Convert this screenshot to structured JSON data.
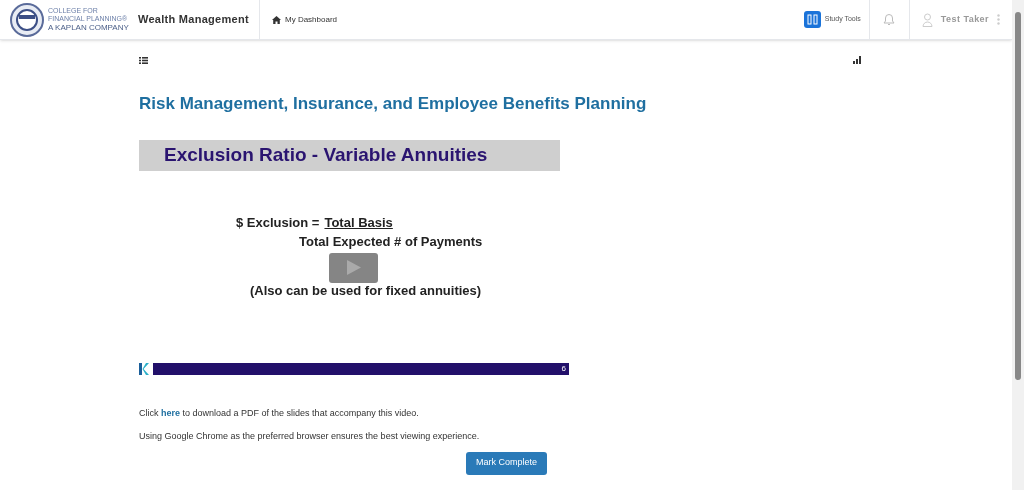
{
  "header": {
    "logo_lines": [
      "COLLEGE FOR",
      "FINANCIAL PLANNING®",
      "A KAPLAN COMPANY"
    ],
    "course": "Wealth Management",
    "dashboard_link": "My Dashboard",
    "study_tools": "Study Tools",
    "user": "Test Taker"
  },
  "lesson": {
    "title": "Risk Management, Insurance, and Employee Benefits Planning",
    "slide": {
      "heading": "Exclusion Ratio - Variable Annuities",
      "numerator_label": "$ Exclusion =",
      "numerator": "Total Basis",
      "denominator": "Total Expected # of Payments",
      "note": "(Also can be used for fixed annuities)",
      "page_number": "6"
    },
    "download_link": "here",
    "download_before": "Click",
    "download_after": "to download a PDF of the slides that accompany this video.",
    "browser_note": "Using Google Chrome as the preferred browser ensures the best viewing experience.",
    "button": "Mark Complete"
  }
}
